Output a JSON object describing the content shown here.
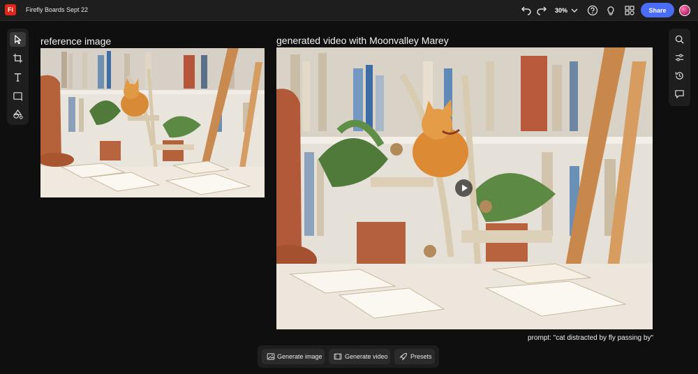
{
  "app": {
    "logo_text": "Fi",
    "document_title": "Firefly Boards Sept 22"
  },
  "topbar": {
    "zoom": "30%",
    "share_label": "Share"
  },
  "left_tools": [
    "select-tool",
    "crop-tool",
    "text-tool",
    "shape-tool",
    "generate-fill-tool"
  ],
  "right_tools": [
    "search",
    "adjustments",
    "history",
    "comments"
  ],
  "canvas": {
    "reference_caption": "reference image",
    "generated_caption": "generated video with Moonvalley Marey",
    "prompt": "prompt: \"cat distracted by fly passing by\""
  },
  "bottom_bar": {
    "generate_image": "Generate image",
    "generate_video": "Generate video",
    "presets": "Presets"
  }
}
